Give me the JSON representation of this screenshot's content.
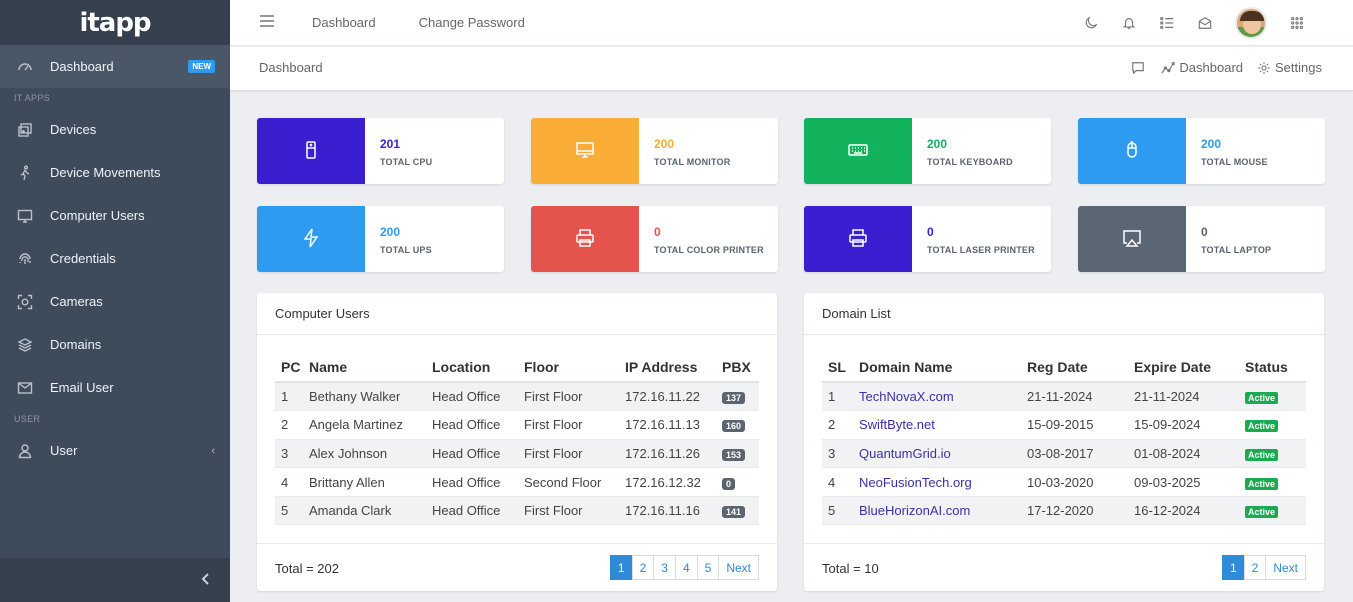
{
  "brand": {
    "logo": "itapp"
  },
  "sidebar": {
    "items": [
      {
        "label": "Dashboard",
        "badge": "NEW",
        "icon": "gauge-icon"
      },
      {
        "caption": "IT APPS"
      },
      {
        "label": "Devices",
        "icon": "devices-icon"
      },
      {
        "label": "Device Movements",
        "icon": "walking-icon"
      },
      {
        "label": "Computer Users",
        "icon": "monitor-icon"
      },
      {
        "label": "Credentials",
        "icon": "fingerprint-icon"
      },
      {
        "label": "Cameras",
        "icon": "camera-icon"
      },
      {
        "label": "Domains",
        "icon": "layers-icon"
      },
      {
        "label": "Email User",
        "icon": "mail-icon"
      },
      {
        "caption": "USER"
      },
      {
        "label": "User",
        "icon": "user-icon"
      }
    ]
  },
  "topbar": {
    "links": [
      "Dashboard",
      "Change Password"
    ],
    "icons": [
      "moon-icon",
      "bell-icon",
      "list-icon",
      "envelope-open-icon",
      "avatar",
      "apps-grid-icon"
    ]
  },
  "breadcrumb": {
    "current": "Dashboard",
    "right_links": [
      "Dashboard",
      "Settings"
    ]
  },
  "stats": [
    {
      "value": "201",
      "label": "TOTAL CPU",
      "color": "#3a1fd1",
      "icon": "cpu-icon"
    },
    {
      "value": "200",
      "label": "TOTAL MONITOR",
      "color": "#f9ad37",
      "icon": "monitor-icon"
    },
    {
      "value": "200",
      "label": "TOTAL KEYBOARD",
      "color": "#13b35e",
      "icon": "keyboard-icon"
    },
    {
      "value": "200",
      "label": "TOTAL MOUSE",
      "color": "#2f9bf0",
      "icon": "mouse-icon"
    },
    {
      "value": "200",
      "label": "TOTAL UPS",
      "color": "#2f9bf0",
      "icon": "bolt-icon"
    },
    {
      "value": "0",
      "label": "TOTAL COLOR PRINTER",
      "color": "#e5534d",
      "icon": "printer-icon"
    },
    {
      "value": "0",
      "label": "TOTAL LASER PRINTER",
      "color": "#3a1fd1",
      "icon": "printer-icon"
    },
    {
      "value": "0",
      "label": "TOTAL LAPTOP",
      "color": "#5b6675",
      "icon": "airplay-icon"
    }
  ],
  "computer_users": {
    "title": "Computer Users",
    "columns": [
      "PC",
      "Name",
      "Location",
      "Floor",
      "IP Address",
      "PBX"
    ],
    "rows": [
      [
        "1",
        "Bethany Walker",
        "Head Office",
        "First Floor",
        "172.16.11.22",
        "137"
      ],
      [
        "2",
        "Angela Martinez",
        "Head Office",
        "First Floor",
        "172.16.11.13",
        "160"
      ],
      [
        "3",
        "Alex Johnson",
        "Head Office",
        "First Floor",
        "172.16.11.26",
        "153"
      ],
      [
        "4",
        "Brittany Allen",
        "Head Office",
        "Second Floor",
        "172.16.12.32",
        "0"
      ],
      [
        "5",
        "Amanda Clark",
        "Head Office",
        "First Floor",
        "172.16.11.16",
        "141"
      ]
    ],
    "total": "Total = 202",
    "pages": [
      "1",
      "2",
      "3",
      "4",
      "5",
      "Next"
    ]
  },
  "domain_list": {
    "title": "Domain List",
    "columns": [
      "SL",
      "Domain Name",
      "Reg Date",
      "Expire Date",
      "Status"
    ],
    "rows": [
      [
        "1",
        "TechNovaX.com",
        "21-11-2024",
        "21-11-2024",
        "Active"
      ],
      [
        "2",
        "SwiftByte.net",
        "15-09-2015",
        "15-09-2024",
        "Active"
      ],
      [
        "3",
        "QuantumGrid.io",
        "03-08-2017",
        "01-08-2024",
        "Active"
      ],
      [
        "4",
        "NeoFusionTech.org",
        "10-03-2020",
        "09-03-2025",
        "Active"
      ],
      [
        "5",
        "BlueHorizonAI.com",
        "17-12-2020",
        "16-12-2024",
        "Active"
      ]
    ],
    "total": "Total = 10",
    "pages": [
      "1",
      "2",
      "Next"
    ]
  }
}
